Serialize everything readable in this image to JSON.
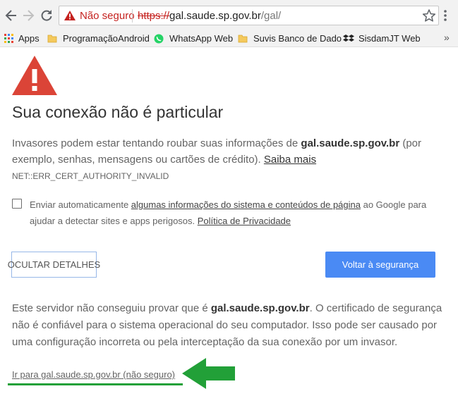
{
  "browser": {
    "security_status": "Não seguro",
    "url_scheme": "https://",
    "url_host": "gal.saude.sp.gov.br",
    "url_path": "/gal/",
    "bookmarks": [
      {
        "label": "Apps",
        "icon": "apps-grid-icon"
      },
      {
        "label": "ProgramaçãoAndroid",
        "icon": "folder-icon"
      },
      {
        "label": "WhatsApp Web",
        "icon": "whatsapp-icon"
      },
      {
        "label": "Suvis Banco de Dado",
        "icon": "folder-icon"
      },
      {
        "label": "SisdamJT Web",
        "icon": "dropbox-icon"
      }
    ],
    "more_bookmarks": "»"
  },
  "page": {
    "title": "Sua conexão não é particular",
    "intro_before": "Invasores podem estar tentando roubar suas informações de ",
    "intro_host": "gal.saude.sp.gov.br",
    "intro_after": " (por exemplo, senhas, mensagens ou cartões de crédito). ",
    "learn_more": "Saiba mais",
    "error_code": "NET::ERR_CERT_AUTHORITY_INVALID",
    "report_before": "Enviar automaticamente ",
    "report_link": "algumas informações do sistema e conteúdos de página",
    "report_after": " ao Google para ajudar a detectar sites e apps perigosos. ",
    "privacy_link": "Política de Privacidade",
    "hide_details_button": "OCULTAR DETALHES",
    "back_to_safety_button": "Voltar à segurança",
    "details_before": "Este servidor não conseguiu provar que é ",
    "details_host": "gal.saude.sp.gov.br",
    "details_after": ". O certificado de segurança não é confiável para o sistema operacional do seu computador. Isso pode ser causado por uma configuração incorreta ou pela interceptação da sua conexão por um invasor.",
    "proceed_link": "Ir para gal.saude.sp.gov.br (não seguro)"
  },
  "colors": {
    "warning_red": "#db4437",
    "primary_blue": "#4a8af4",
    "annotation_green": "#22a038",
    "insecure_text": "#c5221f"
  }
}
